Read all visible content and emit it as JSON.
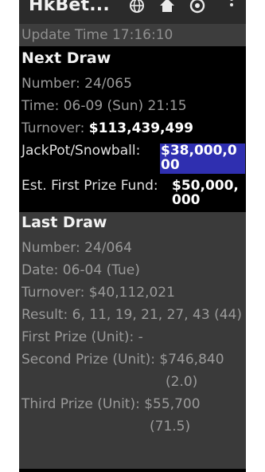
{
  "app": {
    "title": "HkBet..."
  },
  "toolbar": {
    "icons": [
      "globe-icon",
      "home-icon",
      "info-icon",
      "overflow-menu-icon"
    ]
  },
  "update_time": "Update Time 17:16:10",
  "next_draw": {
    "heading": "Next Draw",
    "number": "Number: 24/065",
    "time": "Time: 06-09 (Sun) 21:15",
    "turnover_label": "Turnover: ",
    "turnover_value": "$113,439,499",
    "jackpot_label": "JackPot/Snowball: ",
    "jackpot_value": "$38,000,000",
    "fund_label": "Est. First Prize Fund: ",
    "fund_value": "$50,000,000"
  },
  "last_draw": {
    "heading": "Last Draw",
    "number": "Number: 24/064",
    "date": "Date: 06-04 (Tue)",
    "turnover": "Turnover: $40,112,021",
    "result": "Result: 6, 11, 19, 21, 27, 43 (44)",
    "first_prize": "First Prize (Unit): -",
    "second_prize": "Second Prize (Unit): $746,840",
    "second_units": "(2.0)",
    "third_prize": "Third Prize (Unit): $55,700",
    "third_units": "(71.5)"
  },
  "colors": {
    "background": "#3a3a3a",
    "next_draw_bg": "#000000",
    "highlight": "#2f2fb0",
    "muted_text": "#9a9a9a"
  }
}
